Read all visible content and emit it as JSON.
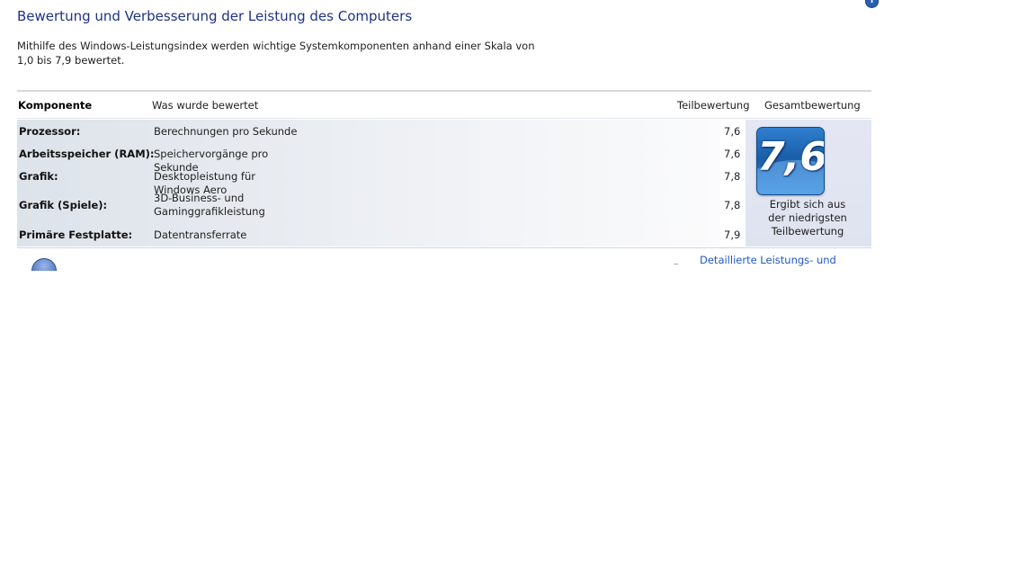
{
  "page": {
    "title": "Bewertung und Verbesserung der Leistung des Computers",
    "intro": "Mithilfe des Windows-Leistungsindex werden wichtige Systemkomponenten anhand einer Skala von 1,0 bis 7,9 bewertet."
  },
  "table": {
    "headers": {
      "komponente": "Komponente",
      "was": "Was wurde bewertet",
      "teil": "Teilbewertung",
      "gesamt": "Gesamtbewertung"
    },
    "rows": [
      {
        "component": "Prozessor:",
        "what": "Berechnungen pro Sekunde",
        "score": "7,6"
      },
      {
        "component": "Arbeitsspeicher (RAM):",
        "what": "Speichervorgänge pro Sekunde",
        "score": "7,6"
      },
      {
        "component": "Grafik:",
        "what": "Desktopleistung für Windows Aero",
        "score": "7,8"
      },
      {
        "component": "Grafik (Spiele):",
        "what": "3D-Business- und Gaminggrafikleistung",
        "score": "7,8"
      },
      {
        "component": "Primäre Festplatte:",
        "what": "Datentransferrate",
        "score": "7,9"
      }
    ],
    "overall": {
      "score": "7,6",
      "note": "Ergibt sich aus der niedrigsten Teilbewertung"
    }
  },
  "footer": {
    "link": "Detaillierte Leistungs- und"
  },
  "icons": {
    "help": "help-icon",
    "windows": "windows-logo-icon"
  }
}
